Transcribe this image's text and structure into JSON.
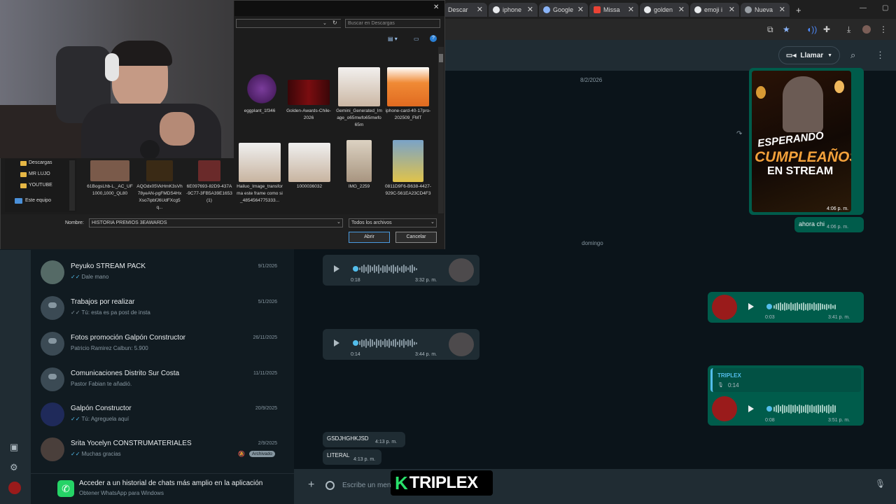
{
  "browser": {
    "tabs": [
      {
        "label": "Descar"
      },
      {
        "label": "iphone"
      },
      {
        "label": "Google"
      },
      {
        "label": "Missa"
      },
      {
        "label": "golden"
      },
      {
        "label": "emoji i"
      },
      {
        "label": "Nueva"
      }
    ],
    "new_tab": "+"
  },
  "file_dialog": {
    "search_placeholder": "Buscar en Descargas",
    "files_row1": [
      "eggplant_1f346",
      "Golden-Awards-Chile-2026",
      "Gemini_Generated_Image_o65mwfo65mwfo65m",
      "iphone-card-40-17pro-202509_FMT"
    ],
    "files_row2": [
      "Hailuo_Image_transforma este frame como si _4854564775333...",
      "1000036032",
      "IMG_2259",
      "0811D9F6-B638-4427-929C-561EA23CD4F3"
    ],
    "files_left": [
      "61BogsLhb-L._AC_UF1000,1000_QL80",
      "AQOdx05VkHmK3sVh78yeAN-pgFMDS4HxXso7ipbfJ6UdFXcg5q...",
      "6E097693-82D9-437A-9C77-3FB5A39E1653 (1)"
    ],
    "tree": [
      "Descargas",
      "MR LUJO",
      "YOUTUBE",
      "Este equipo"
    ],
    "name_label": "Nombre:",
    "name_value": "HISTORIA PREMIOS 3EAWARDS",
    "type_value": "Todos los archivos",
    "open_label": "Abrir",
    "cancel_label": "Cancelar"
  },
  "chat_header": {
    "call_label": "Llamar"
  },
  "chat": {
    "date1": "8/2/2026",
    "date2": "domingo",
    "poster": {
      "line1": "ESPERANDO",
      "line2": "CUMPLEAÑOS",
      "line3": "EN STREAM",
      "time": "4:06 p. m."
    },
    "msg_ahora": {
      "text": "ahora chi",
      "time": "4:06 p. m."
    },
    "voice1": {
      "duration": "0:18",
      "time": "3:32 p. m."
    },
    "voice2": {
      "duration": "0:03",
      "time": "3:41 p. m."
    },
    "voice3": {
      "duration": "0:14",
      "time": "3:44 p. m."
    },
    "voice4": {
      "reply_name": "TRIPLEX",
      "reply_duration": "0:14",
      "duration": "0:08",
      "time": "3:51 p. m."
    },
    "msg_gsd": {
      "text": "GSDJHGHKJSD",
      "time": "4:13 p. m."
    },
    "msg_literal": {
      "text": "LITERAL",
      "time": "4:13 p. m."
    }
  },
  "chat_list": [
    {
      "name": "Peyuko STREAM PACK",
      "preview": "Dale mano",
      "date": "9/1/2026"
    },
    {
      "name": "Trabajos por realizar",
      "preview": "Tú: esta es pa post de insta",
      "date": "5/1/2026"
    },
    {
      "name": "Fotos promoción Galpón Constructor",
      "preview": "Patricio Ramirez Calbun: 5.900",
      "date": "26/11/2025"
    },
    {
      "name": "Comunicaciones Distrito Sur Costa",
      "preview": "Pastor Fabian te añadió.",
      "date": "11/11/2025"
    },
    {
      "name": "Galpón Constructor",
      "preview": "Tú: Agreguela aquí",
      "date": "20/9/2025"
    },
    {
      "name": "Srita Yocelyn CONSTRUMATERIALES",
      "preview": "Muchas gracias",
      "date": "2/9/2025",
      "badge": "Archivado"
    }
  ],
  "promo": {
    "title": "Acceder a un historial de chats más amplio en la aplicación",
    "subtitle": "Obtener WhatsApp para Windows"
  },
  "composer": {
    "placeholder": "Escribe un men"
  },
  "overlay_logo": {
    "k": "K",
    "word": "TRIPLEX"
  },
  "colors": {
    "outgoing_bubble": "#005c4b",
    "incoming_bubble": "#1f2c33",
    "accent": "#25d366"
  }
}
